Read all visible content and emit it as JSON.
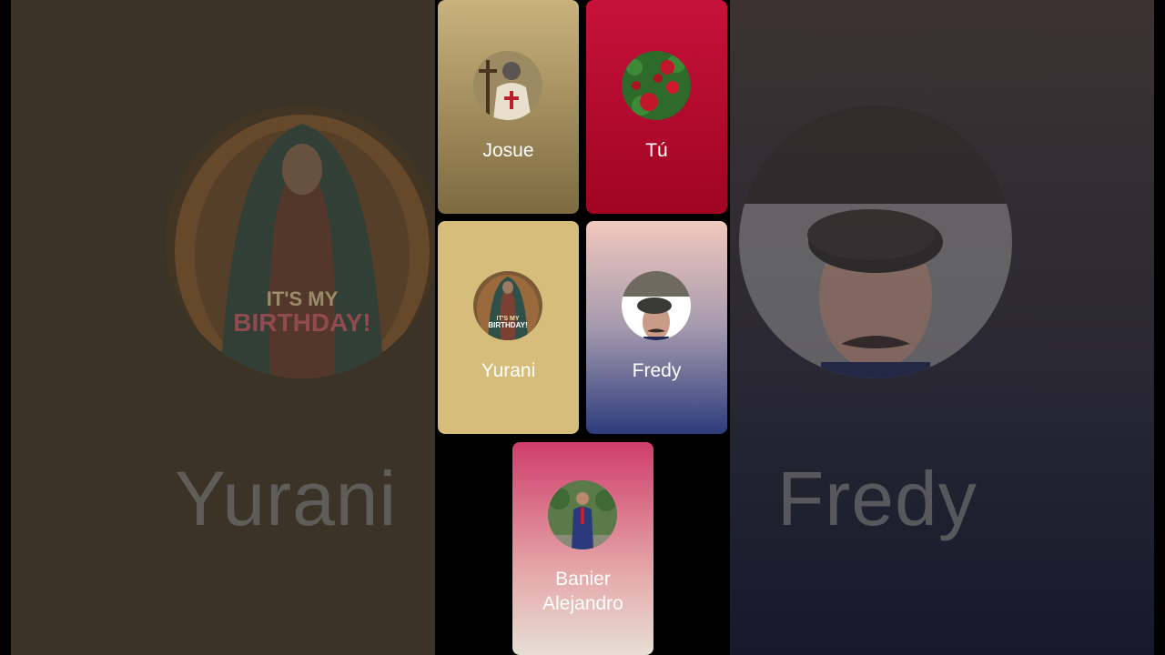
{
  "background": {
    "left_name": "Yurani",
    "right_name": "Fredy",
    "left_badge_line1": "IT'S MY",
    "left_badge_line2": "BIRTHDAY!"
  },
  "participants": [
    {
      "name": "Josue",
      "avatar_icon": "knight-avatar-icon"
    },
    {
      "name": "Tú",
      "avatar_icon": "roses-avatar-icon"
    },
    {
      "name": "Yurani",
      "avatar_icon": "virgin-mary-avatar-icon",
      "badge_line1": "IT'S MY",
      "badge_line2": "BIRTHDAY!"
    },
    {
      "name": "Fredy",
      "avatar_icon": "man-beret-avatar-icon"
    },
    {
      "name_line1": "Banier",
      "name_line2": "Alejandro",
      "avatar_icon": "man-suit-avatar-icon"
    }
  ]
}
